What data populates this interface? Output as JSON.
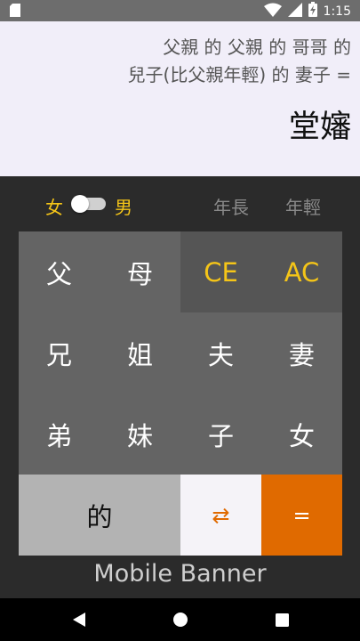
{
  "status": {
    "time": "1:15"
  },
  "display": {
    "expression_line1": "父親 的 父親 的 哥哥 的",
    "expression_line2": "兒子(比父親年輕) 的 妻子 =",
    "result": "堂嬸"
  },
  "gender_toggle": {
    "female": "女",
    "male": "男",
    "selected": "female"
  },
  "age": {
    "older": "年長",
    "younger": "年輕"
  },
  "keys": {
    "father": "父",
    "mother": "母",
    "ce": "CE",
    "ac": "AC",
    "elder_brother": "兄",
    "elder_sister": "姐",
    "husband": "夫",
    "wife": "妻",
    "younger_brother": "弟",
    "younger_sister": "妹",
    "son": "子",
    "daughter": "女",
    "of": "的",
    "swap": "⇄",
    "equals": "="
  },
  "banner": {
    "text": "Mobile Banner"
  },
  "icons": [
    "sd-card-icon",
    "wifi-icon",
    "cellular-signal-icon",
    "battery-charging-icon",
    "back-icon",
    "home-icon",
    "recents-icon"
  ],
  "colors": {
    "accent_yellow": "#f5c518",
    "accent_orange": "#e06a00",
    "display_bg": "#f1eef9",
    "keypad_bg": "#646464"
  }
}
